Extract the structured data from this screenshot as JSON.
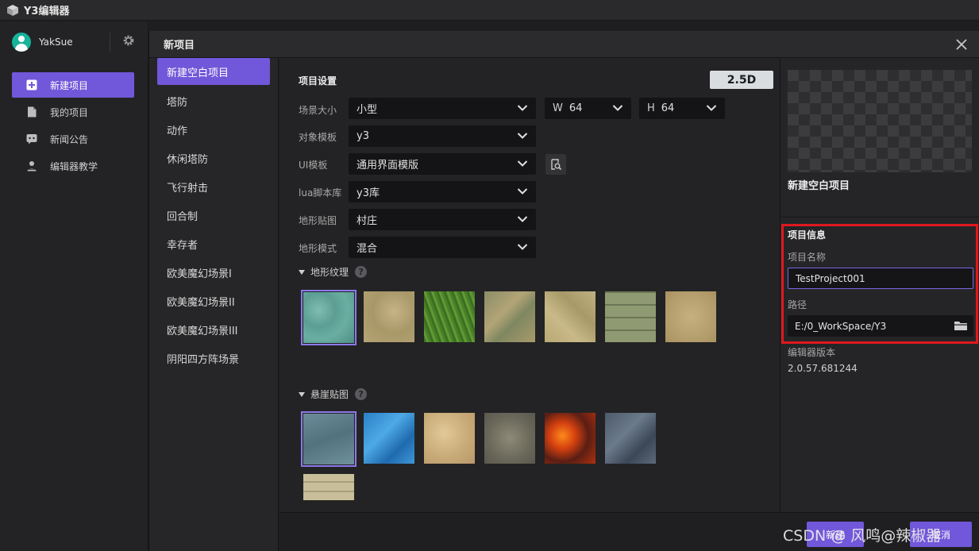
{
  "app": {
    "title": "Y3编辑器",
    "logo_icon": "cube-icon"
  },
  "user": {
    "name": "YakSue"
  },
  "sidebar": {
    "items": [
      {
        "label": "新建项目",
        "icon": "plus-square-icon",
        "active": true
      },
      {
        "label": "我的项目",
        "icon": "file-icon",
        "active": false
      },
      {
        "label": "新闻公告",
        "icon": "chat-icon",
        "active": false
      },
      {
        "label": "编辑器教学",
        "icon": "teacher-icon",
        "active": false
      }
    ]
  },
  "modal": {
    "title": "新项目",
    "templates": [
      {
        "label": "新建空白项目",
        "active": true
      },
      {
        "label": "塔防"
      },
      {
        "label": "动作"
      },
      {
        "label": "休闲塔防"
      },
      {
        "label": "飞行射击"
      },
      {
        "label": "回合制"
      },
      {
        "label": "幸存者"
      },
      {
        "label": "欧美魔幻场景I"
      },
      {
        "label": "欧美魔幻场景II"
      },
      {
        "label": "欧美魔幻场景III"
      },
      {
        "label": "阴阳四方阵场景"
      }
    ],
    "settings": {
      "title": "项目设置",
      "mode": "2.5D",
      "scene_size": {
        "label": "场景大小",
        "value": "小型",
        "w_prefix": "W",
        "w_value": "64",
        "h_prefix": "H",
        "h_value": "64"
      },
      "object_template": {
        "label": "对象模板",
        "value": "y3"
      },
      "ui_template": {
        "label": "UI模板",
        "value": "通用界面模版"
      },
      "lua_library": {
        "label": "lua脚本库",
        "value": "y3库"
      },
      "terrain_texture": {
        "label": "地形贴图",
        "value": "村庄"
      },
      "terrain_mode": {
        "label": "地形模式",
        "value": "混合"
      },
      "terrain_group": {
        "label": "地形纹理"
      },
      "cliff_group": {
        "label": "悬崖贴图"
      }
    },
    "info": {
      "template_name": "新建空白项目",
      "section_title": "项目信息",
      "name_label": "项目名称",
      "name_value": "TestProject001",
      "path_label": "路径",
      "path_value": "E:/0_WorkSpace/Y3",
      "version_label": "编辑器版本",
      "version_value": "2.0.57.681244"
    },
    "footer": {
      "create_label": "新建",
      "cancel_label": "取消"
    }
  },
  "watermark": "CSDN @ 风鸣@辣椒器",
  "colors": {
    "accent": "#7157d9",
    "highlight": "#e0181e"
  }
}
